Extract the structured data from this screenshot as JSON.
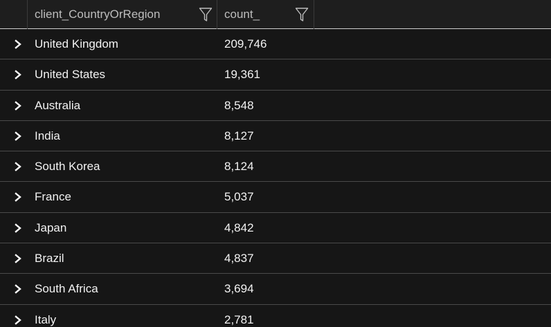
{
  "table": {
    "columns": [
      {
        "label": "client_CountryOrRegion",
        "icon": "filter-icon"
      },
      {
        "label": "count_",
        "icon": "filter-icon"
      }
    ],
    "rows": [
      {
        "country": "United Kingdom",
        "count": "209,746"
      },
      {
        "country": "United States",
        "count": "19,361"
      },
      {
        "country": "Australia",
        "count": "8,548"
      },
      {
        "country": "India",
        "count": "8,127"
      },
      {
        "country": "South Korea",
        "count": "8,124"
      },
      {
        "country": "France",
        "count": "5,037"
      },
      {
        "country": "Japan",
        "count": "4,842"
      },
      {
        "country": "Brazil",
        "count": "4,837"
      },
      {
        "country": "South Africa",
        "count": "3,694"
      },
      {
        "country": "Italy",
        "count": "2,781"
      }
    ],
    "row_expander_icon": "chevron-right-icon"
  },
  "colors": {
    "background": "#161616",
    "header_border": "#d0d0d0",
    "row_border": "#4a4a4a",
    "text": "#f2f2f2",
    "header_text": "#bdbdbd"
  }
}
